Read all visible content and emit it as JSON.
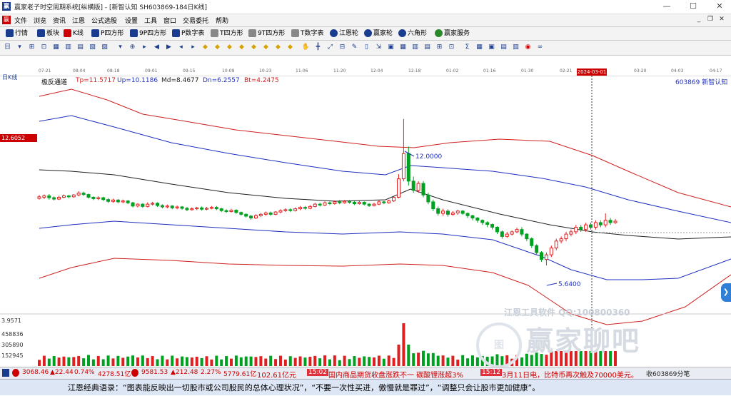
{
  "window": {
    "title": "赢家老子时空周期系统[纵横版] - [新智认知  SH603869-184日K线]",
    "min": "—",
    "max": "☐",
    "close": "✕"
  },
  "menu": {
    "items": [
      "文件",
      "浏览",
      "资讯",
      "江恩",
      "公式选股",
      "设置",
      "工具",
      "窗口",
      "交易委托",
      "帮助"
    ],
    "right": [
      "_",
      "❐",
      "✕"
    ]
  },
  "toolbar1": {
    "items": [
      {
        "label": "行情",
        "color": "#1a3c8f"
      },
      {
        "label": "板块",
        "color": "#1a3c8f"
      },
      {
        "label": "K线",
        "color": "#c00"
      },
      {
        "label": "P四方形",
        "color": "#1a3c8f"
      },
      {
        "label": "9P四方形",
        "color": "#1a3c8f"
      },
      {
        "label": "P数字表",
        "color": "#1a3c8f"
      },
      {
        "label": "T四方形",
        "color": "#888"
      },
      {
        "label": "9T四方形",
        "color": "#888"
      },
      {
        "label": "T数字表",
        "color": "#888"
      },
      {
        "label": "江恩轮",
        "color": "#1a3c8f"
      },
      {
        "label": "赢家轮",
        "color": "#1a3c8f"
      },
      {
        "label": "六角形",
        "color": "#1a3c8f"
      },
      {
        "label": "赢家服务",
        "color": "#2a8a2a"
      }
    ]
  },
  "toolbar2": {
    "glyphs": [
      "日",
      "▾",
      "⊞",
      "⊡",
      "▦",
      "▥",
      "▤",
      "▧",
      "▨",
      "▾",
      "⊕",
      "▸",
      "◀",
      "▶",
      "◂",
      "▸",
      "◆",
      "◆",
      "◆",
      "◆",
      "◆",
      "◆",
      "◆",
      "◆",
      "✋",
      "╋",
      "⤢",
      "⊟",
      "✎",
      "▯",
      "⇲",
      "▣",
      "▦",
      "▥",
      "▤",
      "⊞",
      "⊡",
      "Σ",
      "▦",
      "▣",
      "▤",
      "▥",
      "◉",
      "∞"
    ]
  },
  "dates": [
    "07-21",
    "08-04",
    "08-18",
    "09-01",
    "09-15",
    "10-09",
    "10-23",
    "11-06",
    "11-20",
    "12-04",
    "12-18",
    "01-02",
    "01-16",
    "01-30",
    "02-21",
    "2024-03-01",
    "03-20",
    "04-03",
    "04-17"
  ],
  "chart": {
    "period": "日K线",
    "indicator_name": "极反通道",
    "tp": "Tp=11.5717",
    "up": "Up=10.1186",
    "md": "Md=8.4677",
    "dn": "Dn=6.2557",
    "bt": "Bt=4.2475",
    "stock": "603869  新智认知",
    "current_price_tag": "12.6052",
    "high_label": "12.0000",
    "low_label": "5.6400",
    "colors": {
      "up": "#e02020",
      "down": "#00a020",
      "tp": "#d02020",
      "upband": "#2030c0",
      "md": "#202020",
      "dn": "#2030c0",
      "bt": "#d02020"
    }
  },
  "volume": {
    "labels": [
      "3.9571",
      "458836",
      "305890",
      "152945"
    ]
  },
  "watermark": {
    "line1": "江恩工具软件  QQ:100800360",
    "line2": "赢家聊吧",
    "logo": "图"
  },
  "statusbar": {
    "sh_idx": "3068.46",
    "sh_chg": "▲22.44",
    "sh_pct": "0.74%",
    "sh_amt": "4278.51亿",
    "sz_idx": "9581.53",
    "sz_chg": "▲212.48",
    "sz_pct": "2.27%",
    "sz_amt": "5779.61亿",
    "other_amt": "102.61亿元",
    "news_time1": "15:02",
    "news1": "国内商品期货收盘涨跌不一  碳酸锂涨超3%",
    "news_time2": "15:12",
    "news2": "3月11日电，比特币再次触及70000美元。",
    "right": "收603869分笔"
  },
  "quote": "江恩经典语录：“图表能反映出一切股市或公司股民的总体心理状况”，“不要一次性买进，傲慢就是罪过”，“调整只会让股市更加健康”。",
  "kline": [
    [
      8.55,
      8.62,
      8.5,
      8.7
    ],
    [
      8.6,
      8.66,
      8.52,
      8.72
    ],
    [
      8.66,
      8.58,
      8.5,
      8.74
    ],
    [
      8.58,
      8.52,
      8.46,
      8.64
    ],
    [
      8.52,
      8.6,
      8.48,
      8.66
    ],
    [
      8.6,
      8.66,
      8.56,
      8.72
    ],
    [
      8.66,
      8.62,
      8.56,
      8.7
    ],
    [
      8.62,
      8.7,
      8.58,
      8.74
    ],
    [
      8.7,
      8.78,
      8.64,
      8.86
    ],
    [
      8.78,
      8.72,
      8.66,
      8.84
    ],
    [
      8.72,
      8.6,
      8.54,
      8.76
    ],
    [
      8.6,
      8.54,
      8.48,
      8.64
    ],
    [
      8.54,
      8.58,
      8.48,
      8.64
    ],
    [
      8.58,
      8.5,
      8.44,
      8.62
    ],
    [
      8.5,
      8.42,
      8.36,
      8.56
    ],
    [
      8.42,
      8.48,
      8.36,
      8.54
    ],
    [
      8.48,
      8.4,
      8.34,
      8.52
    ],
    [
      8.4,
      8.44,
      8.34,
      8.5
    ],
    [
      8.44,
      8.36,
      8.3,
      8.48
    ],
    [
      8.36,
      8.22,
      8.16,
      8.4
    ],
    [
      8.22,
      8.3,
      8.16,
      8.34
    ],
    [
      8.3,
      8.2,
      8.14,
      8.34
    ],
    [
      8.2,
      8.3,
      8.16,
      8.38
    ],
    [
      8.3,
      8.34,
      8.24,
      8.4
    ],
    [
      8.34,
      8.24,
      8.18,
      8.38
    ],
    [
      8.24,
      8.18,
      8.12,
      8.3
    ],
    [
      8.18,
      8.22,
      8.12,
      8.28
    ],
    [
      8.22,
      8.14,
      8.08,
      8.26
    ],
    [
      8.14,
      8.18,
      8.08,
      8.24
    ],
    [
      8.18,
      8.12,
      8.06,
      8.22
    ],
    [
      8.12,
      8.06,
      8.0,
      8.18
    ],
    [
      8.06,
      8.1,
      8.02,
      8.16
    ],
    [
      8.1,
      8.14,
      8.04,
      8.18
    ],
    [
      8.14,
      8.08,
      8.02,
      8.2
    ],
    [
      8.08,
      8.12,
      8.04,
      8.18
    ],
    [
      8.12,
      8.16,
      8.08,
      8.22
    ],
    [
      8.16,
      8.1,
      8.04,
      8.22
    ],
    [
      8.1,
      8.02,
      7.96,
      8.14
    ],
    [
      8.02,
      7.98,
      7.92,
      8.08
    ],
    [
      7.98,
      8.04,
      7.94,
      8.1
    ],
    [
      8.04,
      7.94,
      7.88,
      8.08
    ],
    [
      7.94,
      7.86,
      7.8,
      7.98
    ],
    [
      7.86,
      7.78,
      7.72,
      7.9
    ],
    [
      7.78,
      7.7,
      7.62,
      7.84
    ],
    [
      7.7,
      7.8,
      7.66,
      7.86
    ],
    [
      7.8,
      7.86,
      7.74,
      7.92
    ],
    [
      7.86,
      7.92,
      7.8,
      7.98
    ],
    [
      7.92,
      7.86,
      7.8,
      7.98
    ],
    [
      7.86,
      7.96,
      7.82,
      8.0
    ],
    [
      7.96,
      8.02,
      7.9,
      8.08
    ],
    [
      8.02,
      8.06,
      7.96,
      8.12
    ],
    [
      8.06,
      8.02,
      7.96,
      8.12
    ],
    [
      8.02,
      8.1,
      7.98,
      8.16
    ],
    [
      8.1,
      8.16,
      8.04,
      8.22
    ],
    [
      8.16,
      8.12,
      8.06,
      8.22
    ],
    [
      8.12,
      8.2,
      8.08,
      8.26
    ],
    [
      8.2,
      8.3,
      8.16,
      8.36
    ],
    [
      8.3,
      8.26,
      8.2,
      8.36
    ],
    [
      8.26,
      8.36,
      8.22,
      8.42
    ],
    [
      8.36,
      8.32,
      8.26,
      8.42
    ],
    [
      8.32,
      8.4,
      8.28,
      8.46
    ],
    [
      8.4,
      8.36,
      8.3,
      8.48
    ],
    [
      8.36,
      8.42,
      8.32,
      8.48
    ],
    [
      8.42,
      8.38,
      8.32,
      8.48
    ],
    [
      8.38,
      8.32,
      8.26,
      8.44
    ],
    [
      8.32,
      8.38,
      8.28,
      8.44
    ],
    [
      8.38,
      8.3,
      8.24,
      8.42
    ],
    [
      8.3,
      8.24,
      8.18,
      8.34
    ],
    [
      8.24,
      8.3,
      8.2,
      8.36
    ],
    [
      8.3,
      8.4,
      8.26,
      8.46
    ],
    [
      8.4,
      8.36,
      8.3,
      8.44
    ],
    [
      8.36,
      8.44,
      8.32,
      8.5
    ],
    [
      8.44,
      8.6,
      8.4,
      8.66
    ],
    [
      8.6,
      9.4,
      8.56,
      9.6
    ],
    [
      9.4,
      10.5,
      9.3,
      12.0
    ],
    [
      10.5,
      9.3,
      9.1,
      10.8
    ],
    [
      9.3,
      8.9,
      8.8,
      9.5
    ],
    [
      8.9,
      9.2,
      8.8,
      9.3
    ],
    [
      9.2,
      8.7,
      8.6,
      9.3
    ],
    [
      8.7,
      8.4,
      8.3,
      8.8
    ],
    [
      8.4,
      8.1,
      8.0,
      8.5
    ],
    [
      8.1,
      7.9,
      7.8,
      8.2
    ],
    [
      7.9,
      8.0,
      7.8,
      8.1
    ],
    [
      8.0,
      7.86,
      7.76,
      8.08
    ],
    [
      7.86,
      7.92,
      7.8,
      8.0
    ],
    [
      7.92,
      8.0,
      7.84,
      8.06
    ],
    [
      8.0,
      7.9,
      7.84,
      8.04
    ],
    [
      7.9,
      7.8,
      7.7,
      7.94
    ],
    [
      7.8,
      7.7,
      7.6,
      7.84
    ],
    [
      7.7,
      7.6,
      7.5,
      7.74
    ],
    [
      7.6,
      7.5,
      7.4,
      7.64
    ],
    [
      7.5,
      7.42,
      7.3,
      7.56
    ],
    [
      7.42,
      7.3,
      7.2,
      7.46
    ],
    [
      7.3,
      7.1,
      7.0,
      7.34
    ],
    [
      7.1,
      6.9,
      6.8,
      7.16
    ],
    [
      6.9,
      7.0,
      6.84,
      7.1
    ],
    [
      7.0,
      7.1,
      6.94,
      7.16
    ],
    [
      7.1,
      7.2,
      7.04,
      7.28
    ],
    [
      7.2,
      7.0,
      6.9,
      7.3
    ],
    [
      7.0,
      6.8,
      6.7,
      7.04
    ],
    [
      6.8,
      6.5,
      6.4,
      6.86
    ],
    [
      6.5,
      6.2,
      6.1,
      6.56
    ],
    [
      6.2,
      5.9,
      5.8,
      6.26
    ],
    [
      5.9,
      6.1,
      5.64,
      6.2
    ],
    [
      6.1,
      6.4,
      6.0,
      6.5
    ],
    [
      6.4,
      6.7,
      6.3,
      6.8
    ],
    [
      6.7,
      6.8,
      6.6,
      6.9
    ],
    [
      6.8,
      7.0,
      6.7,
      7.1
    ],
    [
      7.0,
      7.1,
      6.9,
      7.2
    ],
    [
      7.1,
      7.3,
      7.0,
      7.4
    ],
    [
      7.3,
      7.2,
      7.1,
      7.4
    ],
    [
      7.2,
      7.4,
      7.1,
      7.5
    ],
    [
      7.4,
      7.3,
      7.2,
      7.5
    ],
    [
      7.3,
      7.5,
      7.2,
      7.6
    ],
    [
      7.5,
      7.4,
      7.3,
      7.6
    ],
    [
      7.4,
      7.6,
      7.3,
      7.9
    ],
    [
      7.6,
      7.5,
      7.4,
      7.7
    ],
    [
      7.5,
      7.56,
      7.44,
      7.66
    ]
  ]
}
